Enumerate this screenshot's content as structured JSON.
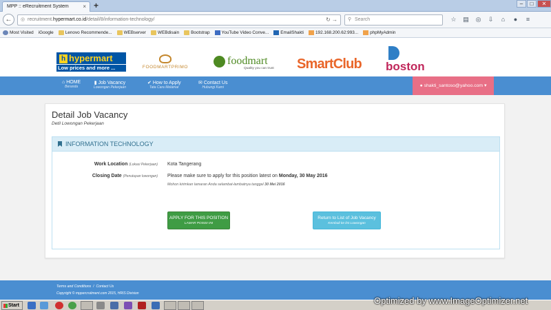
{
  "browser": {
    "tab_title": "MPP :: eRecruitment System",
    "tab_close": "×",
    "new_tab": "+",
    "window_controls": [
      "–",
      "□",
      "✕"
    ],
    "url_prefix": "recruitment.",
    "url_host": "hypermart.co.id",
    "url_path": "/detail/8/information-technology/",
    "search_placeholder": "Search",
    "bookmarks": [
      {
        "label": "Most Visited",
        "icon": "gear"
      },
      {
        "label": "iGoogle",
        "icon": "page"
      },
      {
        "label": "Lenovo Recommende...",
        "icon": "folder"
      },
      {
        "label": "WEBserver",
        "icon": "folder"
      },
      {
        "label": "WEBdisain",
        "icon": "folder"
      },
      {
        "label": "Bootstrap",
        "icon": "folder"
      },
      {
        "label": "YouTube Video Conve...",
        "icon": "yt"
      },
      {
        "label": "EmailShakti",
        "icon": "mail"
      },
      {
        "label": "192.168.200.62:993...",
        "icon": "pma"
      },
      {
        "label": "phpMyAdmin",
        "icon": "pma"
      }
    ]
  },
  "brands": {
    "hypermart": {
      "name": "hypermart",
      "tagline": "Low prices and more ..."
    },
    "foodmart_primo": "FOODMARTPRIMO",
    "foodmart": {
      "name": "foodmart",
      "tagline": "Quality you can trust"
    },
    "smartclub": "SmartClub",
    "boston": "boston"
  },
  "menu": {
    "items": [
      {
        "label": "HOME",
        "sub": "Beranda",
        "icon": "home-icon"
      },
      {
        "label": "Job Vacancy",
        "sub": "Lowongan Pekerjaan",
        "icon": "bookmark-icon"
      },
      {
        "label": "How to Apply",
        "sub": "Tata Cara Melamar",
        "icon": "check-icon"
      },
      {
        "label": "Contact Us",
        "sub": "Hubungi Kami",
        "icon": "envelope-icon"
      }
    ],
    "user_email": "shakti_santoso@yahoo.com"
  },
  "detail": {
    "title": "Detail Job Vacancy",
    "subtitle": "Detil Lowongan Pekerjaan",
    "panel_title": "INFORMATION TECHNOLOGY",
    "work_location_label": "Work Location",
    "work_location_sub": "(Lokasi Pekerjaan)",
    "work_location_value": "Kota Tangerang",
    "closing_date_label": "Closing Date",
    "closing_date_sub": "(Penutupan lowongan)",
    "closing_text": "Please make sure to apply for this position latest on",
    "closing_date": "Monday, 30 May 2016",
    "closing_note_text": "Mohon kirimkan lamaran Anda selambat-lambatnya tanggal",
    "closing_note_date": "30 Mei 2016",
    "apply_button": "APPLY FOR THIS POSITION",
    "apply_button_sub": "LAMAR POSISI INI",
    "return_button": "Return to List of Job Vacancy",
    "return_button_sub": "Kembali ke list Lowongan"
  },
  "footer": {
    "terms": "Terms and Conditions",
    "separator": "/",
    "contact": "Contact Us",
    "copyright": "Copyright © mppercruitment.com 2015, HRIS Division"
  },
  "taskbar": {
    "start": "Start"
  },
  "watermark": "Optimized by www.ImageOptimizer.net",
  "colors": {
    "menu_blue": "#4a8ed1",
    "user_pink": "#e86f86",
    "panel_head": "#d9edf7",
    "apply_green": "#3f9c44",
    "return_cyan": "#5bc0de"
  }
}
